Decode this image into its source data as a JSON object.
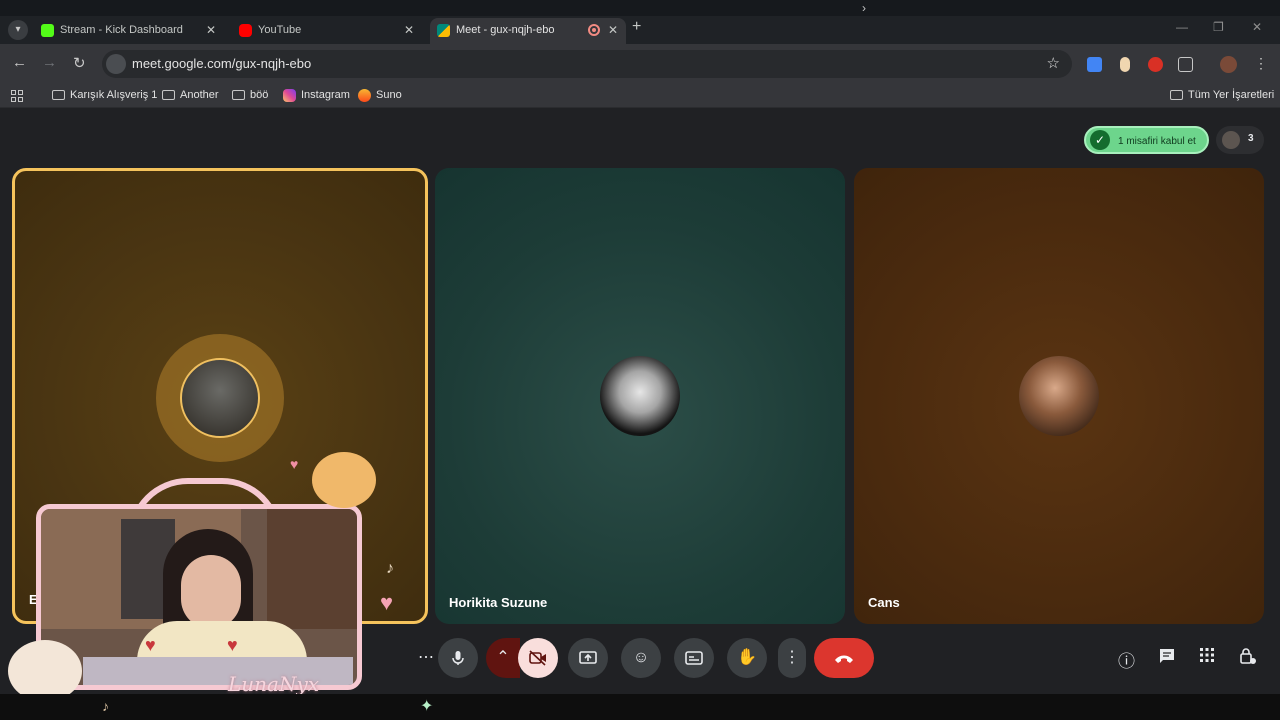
{
  "browser": {
    "tabs": [
      {
        "title": "Stream - Kick Dashboard",
        "favicon_color": "#53fc18",
        "active": false
      },
      {
        "title": "YouTube",
        "favicon_color": "#ff0000",
        "active": false
      },
      {
        "title": "Meet - gux-nqjh-ebo",
        "favicon_color": "#00897b",
        "active": true
      }
    ],
    "url": "meet.google.com/gux-nqjh-ebo",
    "bookmarks": [
      {
        "label": "Karışık Alışveriş 1",
        "icon": "folder-icon"
      },
      {
        "label": "Another",
        "icon": "folder-icon"
      },
      {
        "label": "böö",
        "icon": "folder-icon"
      },
      {
        "label": "Instagram",
        "icon": "instagram-icon"
      },
      {
        "label": "Suno",
        "icon": "suno-icon"
      }
    ],
    "all_bookmarks_label": "Tüm Yer İşaretleri"
  },
  "meet": {
    "admit_label": "1 misafiri kabul et",
    "participant_count": "3",
    "tiles": [
      {
        "name": "E",
        "bg": "#4a3512",
        "active_speaker": true
      },
      {
        "name": "Horikita Suzune",
        "bg": "#1d3c37"
      },
      {
        "name": "Cans",
        "bg": "#4a2a0e"
      }
    ],
    "controls": [
      "more-options-icon",
      "microphone-icon",
      "caret-up-icon",
      "camera-off-icon",
      "present-screen-icon",
      "emoji-icon",
      "captions-icon",
      "raise-hand-icon",
      "more-vert-icon",
      "end-call-icon"
    ],
    "side_controls": [
      "info-icon",
      "chat-icon",
      "activities-icon",
      "host-controls-icon"
    ],
    "colors": {
      "accent_green": "#6dd58c",
      "end_call": "#dc362e",
      "speaker_border": "#f5c35c"
    }
  },
  "overlay": {
    "brand_text": "LunaNyx"
  }
}
